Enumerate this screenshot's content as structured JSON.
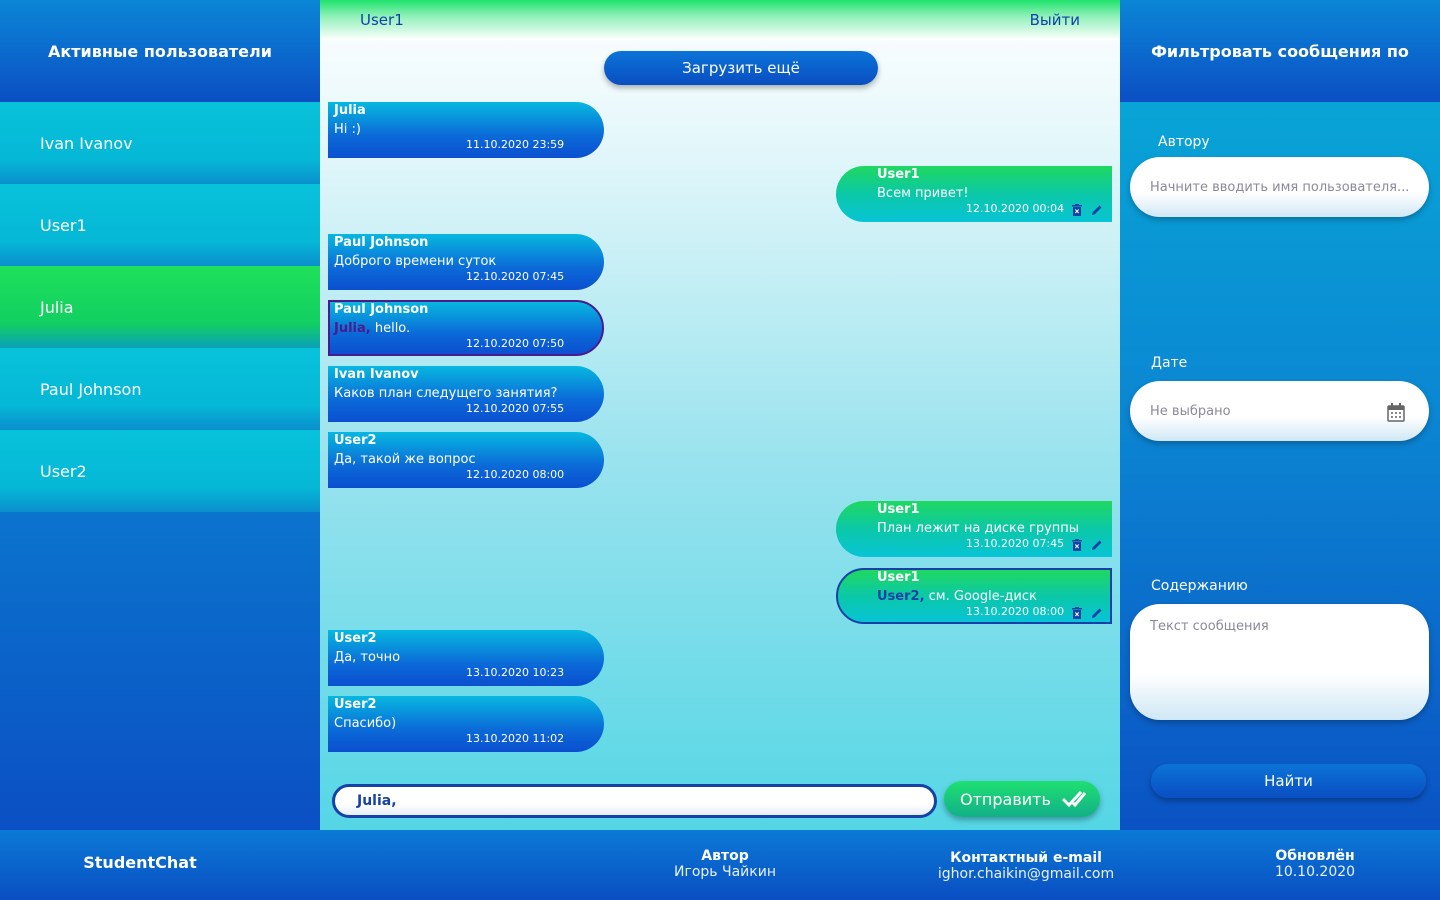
{
  "left_panel": {
    "title": "Активные пользователи",
    "users": [
      "Ivan Ivanov",
      "User1",
      "Julia",
      "Paul Johnson",
      "User2"
    ]
  },
  "header": {
    "current_user": "User1",
    "logout_label": "Выйти"
  },
  "load_more_label": "Загрузить ещё",
  "messages": [
    {
      "author": "Julia",
      "text": "Hi :)",
      "time": "11.10.2020 23:59"
    },
    {
      "author": "User1",
      "text": "Всем привет!",
      "time": "12.10.2020 00:04"
    },
    {
      "author": "Paul Johnson",
      "text": "Доброго времени суток",
      "time": "12.10.2020 07:45"
    },
    {
      "author": "Paul Johnson",
      "mention": "Julia,",
      "text": " hello.",
      "time": "12.10.2020 07:50"
    },
    {
      "author": "Ivan Ivanov",
      "text": "Каков план следущего занятия?",
      "time": "12.10.2020 07:55"
    },
    {
      "author": "User2",
      "text": "Да, такой же вопрос",
      "time": "12.10.2020 08:00"
    },
    {
      "author": "User1",
      "text": "План лежит на диске группы",
      "time": "13.10.2020 07:45"
    },
    {
      "author": "User1",
      "mention": "User2,",
      "text": " см. Google-диск",
      "time": "13.10.2020 08:00"
    },
    {
      "author": "User2",
      "text": "Да, точно",
      "time": "13.10.2020 10:23"
    },
    {
      "author": "User2",
      "text": "Спасибо)",
      "time": "13.10.2020 11:02"
    }
  ],
  "composer": {
    "value": "Julia,",
    "send_label": "Отправить"
  },
  "filter_panel": {
    "title": "Фильтровать сообщения по",
    "author_label": "Автору",
    "author_placeholder": "Начните вводить имя пользователя...",
    "date_label": "Дате",
    "date_placeholder": "Не выбрано",
    "content_label": "Содержанию",
    "content_placeholder": "Текст сообщения",
    "find_label": "Найти"
  },
  "footer": {
    "brand": "StudentChat",
    "author_title": "Автор",
    "author_value": "Игорь Чайкин",
    "email_title": "Контактный e-mail",
    "email_value": "ighor.chaikin@gmail.com",
    "updated_title": "Обновлён",
    "updated_value": "10.10.2020"
  },
  "colors": {
    "accent_blue": "#0b4fc4",
    "accent_green": "#1ee05a",
    "cyan": "#08c2da",
    "mention_purple": "#4b1a8e",
    "mention_blue": "#1542a6"
  }
}
